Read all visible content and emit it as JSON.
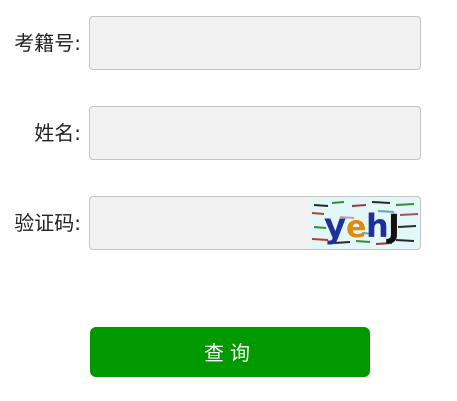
{
  "form": {
    "fields": [
      {
        "label": "考籍号:",
        "value": "",
        "placeholder": ""
      },
      {
        "label": "姓名:",
        "value": "",
        "placeholder": ""
      },
      {
        "label": "验证码:",
        "value": "",
        "placeholder": ""
      }
    ],
    "captcha": {
      "text": "yehJ"
    },
    "submit_label": "查询"
  },
  "colors": {
    "field_bg": "#f2f2f2",
    "field_border": "#c4c4c4",
    "button_bg": "#009900",
    "button_text": "#ffffff"
  }
}
